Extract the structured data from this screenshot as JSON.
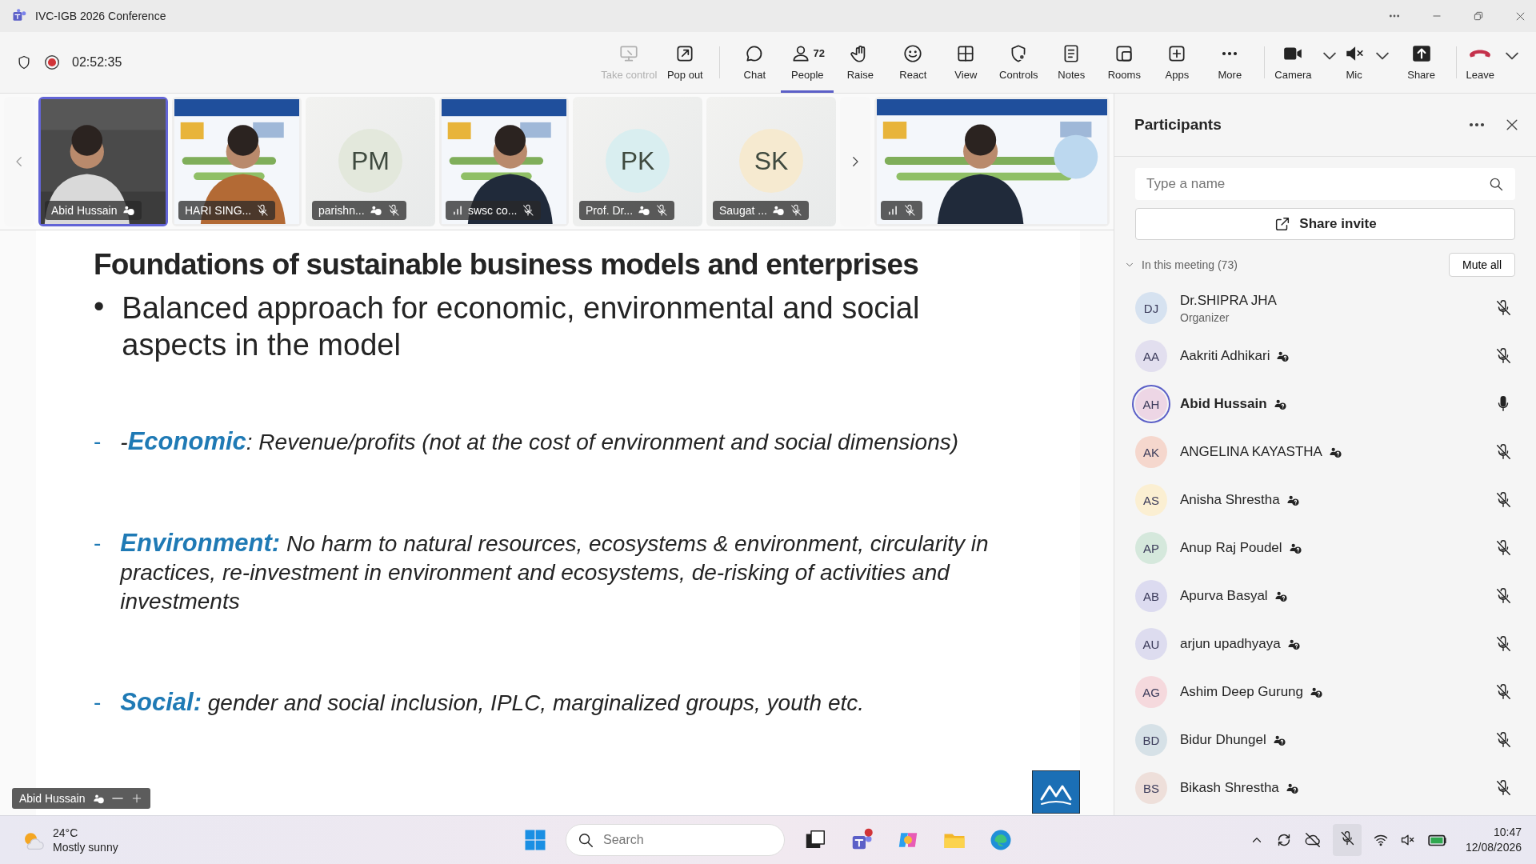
{
  "window": {
    "title": "IVC-IGB 2026 Conference"
  },
  "meeting": {
    "timer": "02:52:35",
    "recording": true
  },
  "toolbar": [
    {
      "items": [
        {
          "kind": "take-control",
          "label": "Take control",
          "selected": false,
          "disabled": true,
          "dropdown": false
        },
        {
          "kind": "pop-out",
          "label": "Pop out",
          "selected": false,
          "disabled": false,
          "dropdown": false
        }
      ]
    },
    {
      "items": [
        {
          "kind": "chat",
          "label": "Chat",
          "selected": false,
          "disabled": false,
          "dropdown": false
        },
        {
          "kind": "people",
          "label": "People",
          "badge": "72",
          "selected": true,
          "disabled": false,
          "dropdown": false
        },
        {
          "kind": "raise",
          "label": "Raise",
          "selected": false,
          "disabled": false,
          "dropdown": false
        },
        {
          "kind": "react",
          "label": "React",
          "selected": false,
          "disabled": false,
          "dropdown": false
        },
        {
          "kind": "view",
          "label": "View",
          "selected": false,
          "disabled": false,
          "dropdown": false
        },
        {
          "kind": "controls",
          "label": "Controls",
          "selected": false,
          "disabled": false,
          "dropdown": false
        },
        {
          "kind": "notes",
          "label": "Notes",
          "selected": false,
          "disabled": false,
          "dropdown": false
        },
        {
          "kind": "rooms",
          "label": "Rooms",
          "selected": false,
          "disabled": false,
          "dropdown": false
        },
        {
          "kind": "apps",
          "label": "Apps",
          "selected": false,
          "disabled": false,
          "dropdown": false
        },
        {
          "kind": "more",
          "label": "More",
          "selected": false,
          "disabled": false,
          "dropdown": false
        }
      ]
    },
    {
      "items": [
        {
          "kind": "camera",
          "label": "Camera",
          "selected": false,
          "disabled": false,
          "dropdown": true
        },
        {
          "kind": "mic",
          "label": "Mic",
          "selected": false,
          "disabled": false,
          "dropdown": true
        },
        {
          "kind": "share",
          "label": "Share",
          "selected": false,
          "disabled": false,
          "dropdown": false
        }
      ]
    },
    {
      "items": [
        {
          "kind": "leave",
          "label": "Leave",
          "selected": false,
          "disabled": false,
          "dropdown": true
        }
      ]
    }
  ],
  "video_strip": {
    "tiles": [
      {
        "kind": "video",
        "name": "Abid Hussain",
        "selected": true,
        "unverified": true,
        "muted": false,
        "signal": false
      },
      {
        "kind": "video",
        "name": "HARI SING...",
        "selected": false,
        "unverified": false,
        "muted": true,
        "signal": false
      },
      {
        "kind": "avatar",
        "name": "parishn...",
        "initials": "PM",
        "color": "#e3e8dc",
        "selected": false,
        "unverified": true,
        "muted": true,
        "signal": false
      },
      {
        "kind": "video",
        "name": "swsc co...",
        "selected": false,
        "unverified": false,
        "muted": true,
        "signal": true
      },
      {
        "kind": "avatar",
        "name": "Prof. Dr...",
        "initials": "PK",
        "color": "#d9eef0",
        "selected": false,
        "unverified": true,
        "muted": true,
        "signal": false
      },
      {
        "kind": "avatar",
        "name": "Saugat ...",
        "initials": "SK",
        "color": "#f6ead0",
        "selected": false,
        "unverified": true,
        "muted": true,
        "signal": false
      },
      {
        "kind": "video",
        "selected": false,
        "unverified": false,
        "muted": true,
        "signal": true
      }
    ]
  },
  "slide": {
    "title": "Foundations of sustainable business models and enterprises",
    "bullet": {
      "marker": "•",
      "text": "Balanced approach for economic, environmental and social aspects in the model"
    },
    "points": [
      {
        "marker": "-",
        "text": "-**Economic**: Revenue/profits (not at the cost of environment and social dimensions)"
      },
      {
        "marker": "-",
        "text": "**Environment:** No harm to natural resources, ecosystems & environment, circularity in practices,  re-investment in environment and ecosystems, de-risking of activities and investments"
      },
      {
        "marker": "-",
        "text": "**Social:** gender and social inclusion, IPLC, marginalized groups, youth etc."
      }
    ]
  },
  "stage_label": {
    "name": "Abid Hussain",
    "unverified": true
  },
  "participants": {
    "title": "Participants",
    "search": {
      "placeholder": "Type a name"
    },
    "share_invite": "Share invite",
    "section": {
      "label": "In this meeting (73)",
      "expanded": true
    },
    "mute_all": "Mute all",
    "people": [
      {
        "initials": "DJ",
        "name": "Dr.SHIPRA JHA",
        "subtitle": "Organizer",
        "color": "#d6e2f0",
        "unverified": false,
        "muted": true,
        "speaking": false
      },
      {
        "initials": "AA",
        "name": "Aakriti Adhikari",
        "color": "#e2dfef",
        "unverified": true,
        "muted": true,
        "speaking": false
      },
      {
        "initials": "AH",
        "name": "Abid Hussain",
        "color": "#edd6e5",
        "unverified": true,
        "muted": false,
        "speaking": true
      },
      {
        "initials": "AK",
        "name": "ANGELINA KAYASTHA",
        "color": "#f5d7cd",
        "unverified": true,
        "muted": true,
        "speaking": false
      },
      {
        "initials": "AS",
        "name": "Anisha Shrestha",
        "color": "#fbefd2",
        "unverified": true,
        "muted": true,
        "speaking": false
      },
      {
        "initials": "AP",
        "name": "Anup Raj Poudel",
        "color": "#d5e8dc",
        "unverified": true,
        "muted": true,
        "speaking": false
      },
      {
        "initials": "AB",
        "name": "Apurva Basyal",
        "color": "#dcdbf0",
        "unverified": true,
        "muted": true,
        "speaking": false
      },
      {
        "initials": "AU",
        "name": "arjun upadhyaya",
        "color": "#dddcef",
        "unverified": true,
        "muted": true,
        "speaking": false
      },
      {
        "initials": "AG",
        "name": "Ashim Deep Gurung",
        "color": "#f5d9dd",
        "unverified": true,
        "muted": true,
        "speaking": false
      },
      {
        "initials": "BD",
        "name": "Bidur Dhungel",
        "color": "#d6e1e7",
        "unverified": true,
        "muted": true,
        "speaking": false
      },
      {
        "initials": "BS",
        "name": "Bikash Shrestha",
        "color": "#eedfda",
        "unverified": true,
        "muted": true,
        "speaking": false
      }
    ]
  },
  "taskbar": {
    "weather": {
      "temperature": "24°C",
      "condition": "Mostly sunny"
    },
    "search": {
      "placeholder": "Search"
    },
    "time": "10:47",
    "date": "12/08/2026"
  }
}
